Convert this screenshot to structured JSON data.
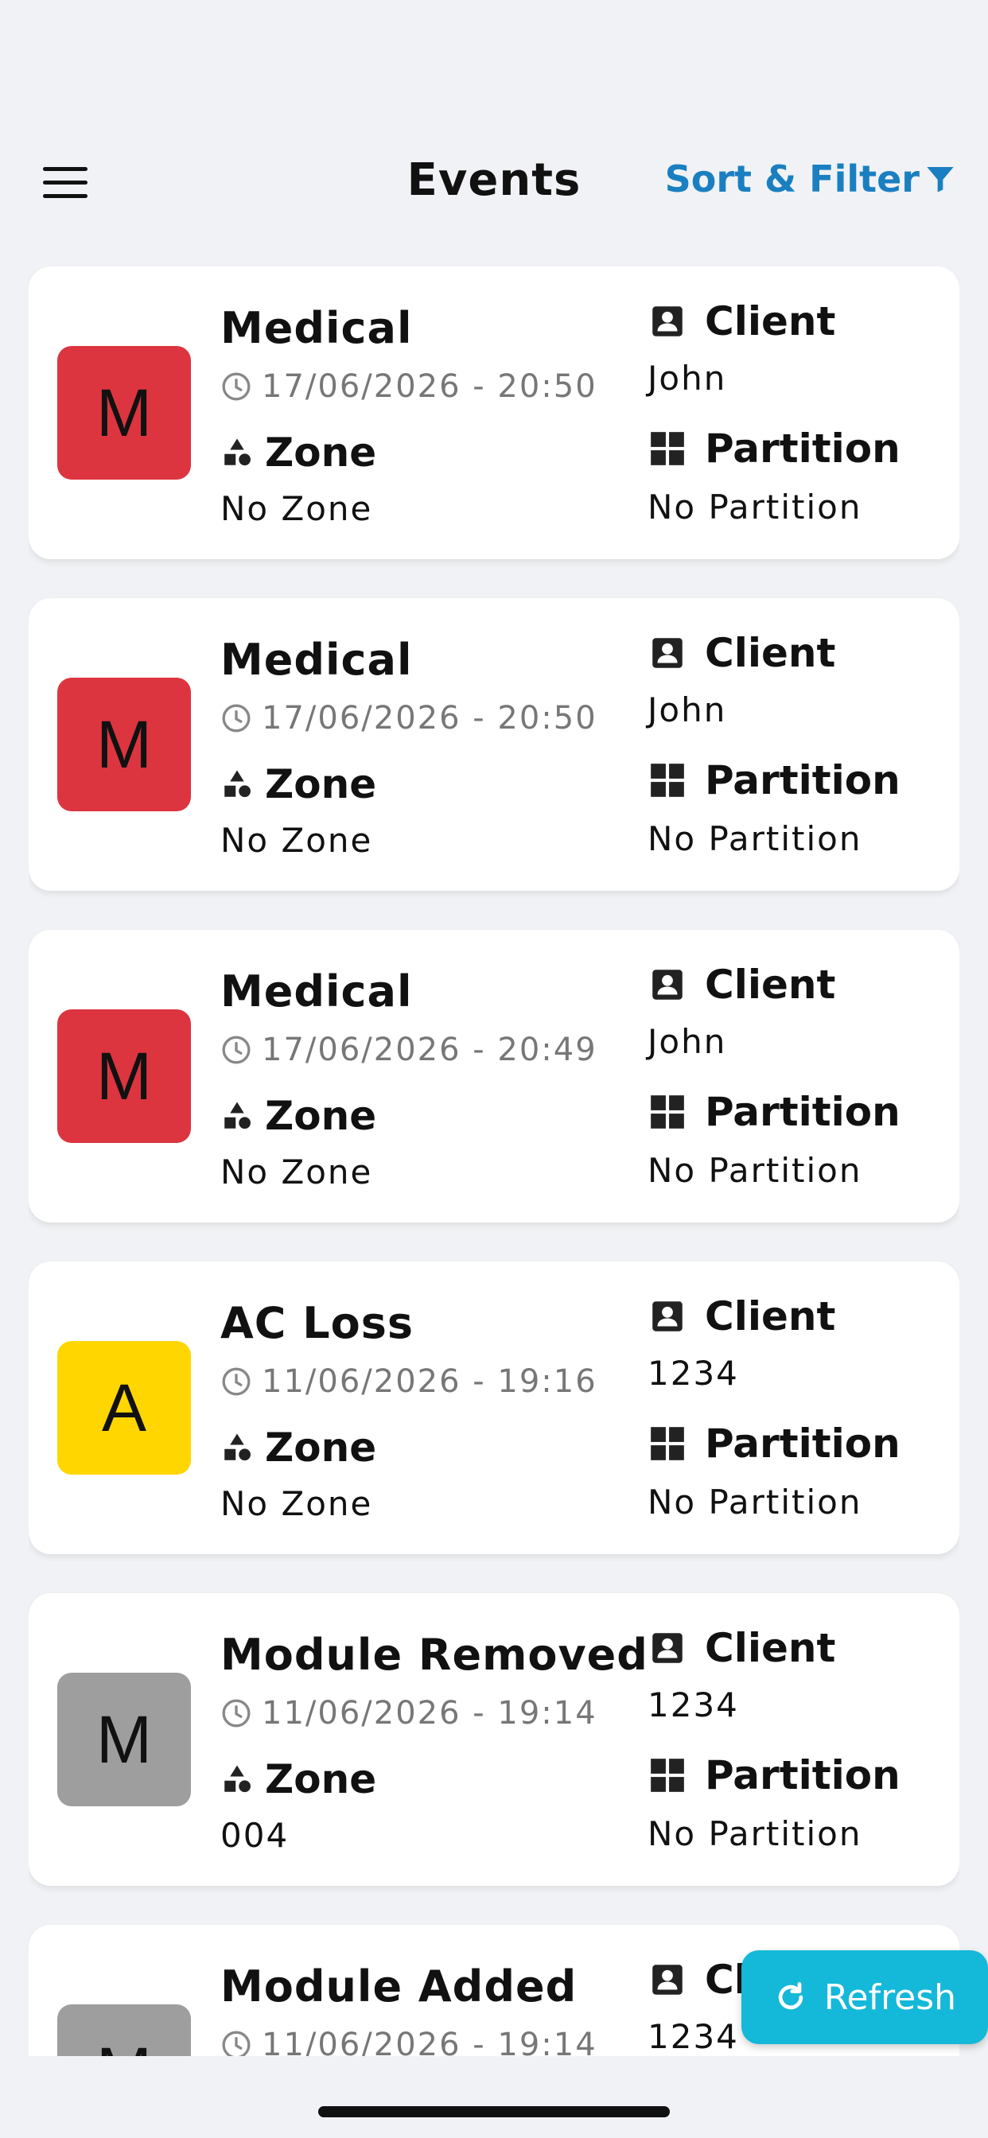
{
  "header": {
    "title": "Events",
    "sort_filter_label": "Sort & Filter"
  },
  "labels": {
    "zone": "Zone",
    "client": "Client",
    "partition": "Partition"
  },
  "events": [
    {
      "letter": "M",
      "color": "#dc3540",
      "title": "Medical",
      "time": "17/06/2026 - 20:50",
      "zone": "No Zone",
      "client": "John",
      "partition": "No Partition"
    },
    {
      "letter": "M",
      "color": "#dc3540",
      "title": "Medical",
      "time": "17/06/2026 - 20:50",
      "zone": "No Zone",
      "client": "John",
      "partition": "No Partition"
    },
    {
      "letter": "M",
      "color": "#dc3540",
      "title": "Medical",
      "time": "17/06/2026 - 20:49",
      "zone": "No Zone",
      "client": "John",
      "partition": "No Partition"
    },
    {
      "letter": "A",
      "color": "#ffd600",
      "title": "AC Loss",
      "time": "11/06/2026 - 19:16",
      "zone": "No Zone",
      "client": "1234",
      "partition": "No Partition"
    },
    {
      "letter": "M",
      "color": "#9e9e9e",
      "title": "Module Removed",
      "time": "11/06/2026 - 19:14",
      "zone": "004",
      "client": "1234",
      "partition": "No Partition"
    },
    {
      "letter": "M",
      "color": "#9e9e9e",
      "title": "Module Added",
      "time": "11/06/2026 - 19:14",
      "zone": "",
      "client": "1234",
      "partition": ""
    }
  ],
  "refresh_label": "Refresh",
  "colors": {
    "accent": "#1a7fc1",
    "refresh_bg": "#14b8d9"
  }
}
